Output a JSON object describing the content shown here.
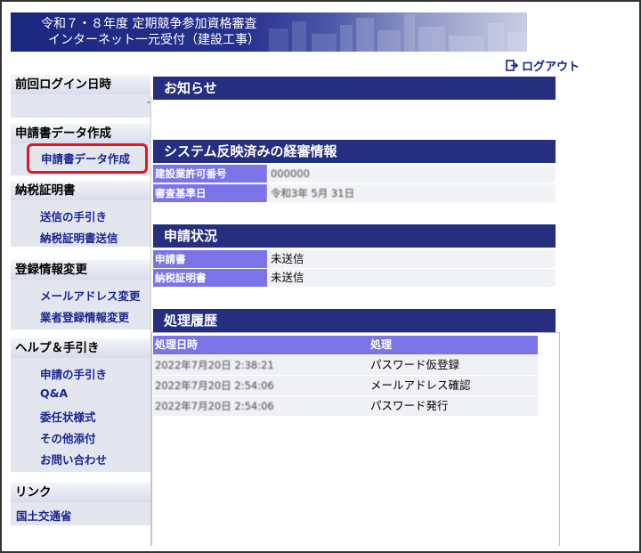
{
  "header": {
    "title_line1": "令和７・８年度 定期競争参加資格審査",
    "title_line2": "インターネット一元受付（建設工事）",
    "logout_label": "ログアウト"
  },
  "sidebar": {
    "last_login": {
      "heading": "前回ログイン日時",
      "value": "-"
    },
    "application_data": {
      "heading": "申請書データ作成",
      "items": [
        "申請書データ作成"
      ]
    },
    "tax_certificate": {
      "heading": "納税証明書",
      "items": [
        "送信の手引き",
        "納税証明書送信"
      ]
    },
    "registration_change": {
      "heading": "登録情報変更",
      "items": [
        "メールアドレス変更",
        "業者登録情報変更"
      ]
    },
    "help": {
      "heading": "ヘルプ＆手引き",
      "items": [
        "申請の手引き",
        "Q&A",
        "委任状様式",
        "その他添付",
        "お問い合わせ"
      ]
    },
    "links": {
      "heading": "リンク",
      "items": [
        "国土交通省"
      ]
    }
  },
  "main": {
    "notice": {
      "heading": "お知らせ"
    },
    "review_info": {
      "heading": "システム反映済みの経審情報",
      "rows": [
        {
          "label": "建設業許可番号",
          "value": "000000"
        },
        {
          "label": "審査基準日",
          "value": "令和3年 5月 31日"
        }
      ]
    },
    "application_status": {
      "heading": "申請状況",
      "rows": [
        {
          "label": "申請書",
          "value": "未送信"
        },
        {
          "label": "納税証明書",
          "value": "未送信"
        }
      ]
    },
    "history": {
      "heading": "処理履歴",
      "columns": [
        "処理日時",
        "処理"
      ],
      "rows": [
        {
          "datetime": "2022年7月20日 2:38:21",
          "action": "パスワード仮登録"
        },
        {
          "datetime": "2022年7月20日 2:54:06",
          "action": "メールアドレス確認"
        },
        {
          "datetime": "2022年7月20日 2:54:06",
          "action": "パスワード発行"
        }
      ]
    }
  },
  "colors": {
    "header_bar": "#262f7f",
    "label_cell": "#7a74e8",
    "link_text": "#1a2690",
    "highlight": "#e0191f"
  }
}
